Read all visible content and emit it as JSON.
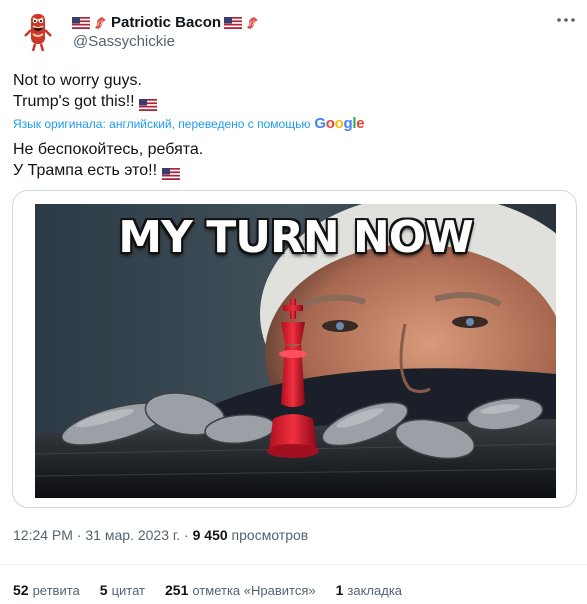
{
  "author": {
    "display_name": "Patriotic Bacon",
    "handle": "@Sassychickie"
  },
  "tweet": {
    "text_line1": "Not to worry guys.",
    "text_line2": "Trump's got this!!",
    "translation_notice": "Язык оригинала: английский, переведено с помощью",
    "translation_provider": "Google",
    "translated_line1": "Не беспокойтесь, ребята.",
    "translated_line2": "У Трампа есть это!!"
  },
  "media": {
    "caption": "MY TURN NOW"
  },
  "meta": {
    "time": "12:24 PM",
    "separator": "·",
    "date": "31 мар. 2023 г.",
    "views_count": "9 450",
    "views_label": "просмотров"
  },
  "stats": {
    "retweets_count": "52",
    "retweets_label": "ретвита",
    "quotes_count": "5",
    "quotes_label": "цитат",
    "likes_count": "251",
    "likes_label": "отметка «Нравится»",
    "bookmarks_count": "1",
    "bookmarks_label": "закладка"
  },
  "icons": {
    "flag": "us-flag-icon",
    "bacon": "bacon-icon",
    "more": "more-icon"
  },
  "colors": {
    "link_blue": "#1d9bf0",
    "muted": "#536471",
    "text": "#0f1419",
    "border": "#cfd9de"
  }
}
